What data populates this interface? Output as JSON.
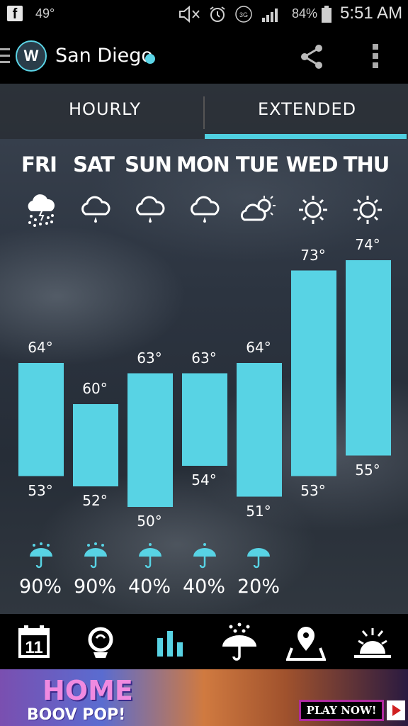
{
  "status_bar": {
    "temperature": "49°",
    "battery": "84%",
    "time": "5:51 AM"
  },
  "app_bar": {
    "logo_text": "W",
    "city": "San Diego",
    "accent_color": "#4fcfe0"
  },
  "tabs": [
    {
      "label": "HOURLY",
      "selected": false
    },
    {
      "label": "EXTENDED",
      "selected": true
    }
  ],
  "forecast": [
    {
      "day": "FRI",
      "icon": "rain-snow-cloud-icon",
      "high": 64,
      "low": 53,
      "high_label": "64°",
      "low_label": "53°",
      "precip": "90%"
    },
    {
      "day": "SAT",
      "icon": "rain-cloud-icon",
      "high": 60,
      "low": 52,
      "high_label": "60°",
      "low_label": "52°",
      "precip": "90%"
    },
    {
      "day": "SUN",
      "icon": "rain-cloud-icon",
      "high": 63,
      "low": 50,
      "high_label": "63°",
      "low_label": "50°",
      "precip": "40%"
    },
    {
      "day": "MON",
      "icon": "rain-cloud-icon",
      "high": 63,
      "low": 54,
      "high_label": "63°",
      "low_label": "54°",
      "precip": "40%"
    },
    {
      "day": "TUE",
      "icon": "partly-cloudy-icon",
      "high": 64,
      "low": 51,
      "high_label": "64°",
      "low_label": "51°",
      "precip": "20%"
    },
    {
      "day": "WED",
      "icon": "sun-icon",
      "high": 73,
      "low": 53,
      "high_label": "73°",
      "low_label": "53°",
      "precip": ""
    },
    {
      "day": "THU",
      "icon": "sun-icon",
      "high": 74,
      "low": 55,
      "high_label": "74°",
      "low_label": "55°",
      "precip": ""
    }
  ],
  "bottom_nav": [
    {
      "icon": "calendar-icon",
      "selected": false
    },
    {
      "icon": "radar-globe-icon",
      "selected": false
    },
    {
      "icon": "bar-chart-icon",
      "selected": true
    },
    {
      "icon": "umbrella-rain-icon",
      "selected": false
    },
    {
      "icon": "map-pin-icon",
      "selected": false
    },
    {
      "icon": "sunrise-icon",
      "selected": false
    }
  ],
  "ad": {
    "title": "HOME",
    "subtitle": "BOOV POP!",
    "cta": "PLAY NOW!"
  }
}
